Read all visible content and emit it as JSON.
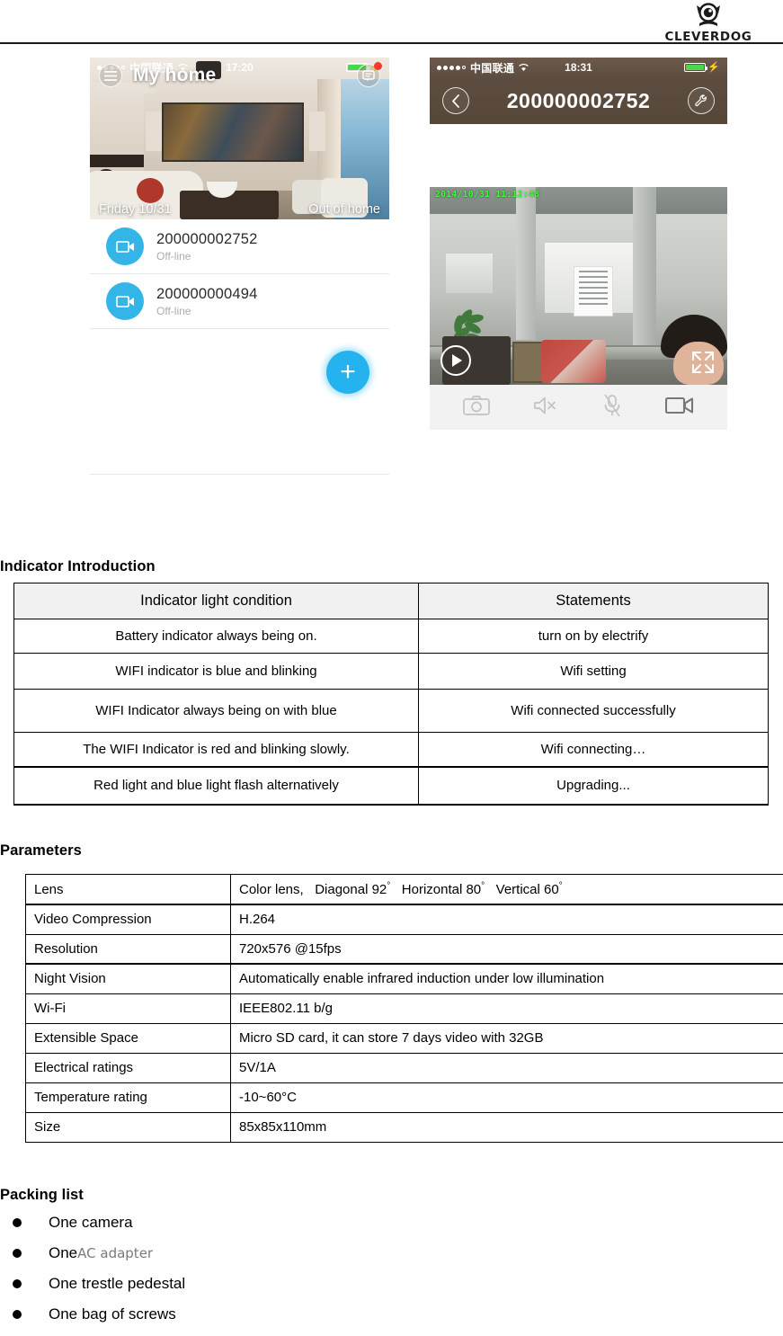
{
  "header": {
    "logo_text": "CLEVERDOG",
    "logo_icon": "cleverdog-camera-logo"
  },
  "app_screens": {
    "left": {
      "status_bar": {
        "carrier": "中国联通",
        "time": "17:20",
        "signal_icon": "signal-dots",
        "wifi_icon": "wifi-icon",
        "battery_icon": "battery-charging-icon"
      },
      "nav": {
        "menu_icon": "hamburger-menu-icon",
        "title": "My home",
        "message_icon": "message-bubble-icon",
        "badge": ""
      },
      "hero": {
        "date": "Friday  10/31",
        "mode": "Out of home"
      },
      "devices": [
        {
          "id": "200000002752",
          "status": "Off-line",
          "icon": "video-camera-icon"
        },
        {
          "id": "200000000494",
          "status": "Off-line",
          "icon": "video-camera-icon"
        }
      ],
      "fab": {
        "label": "+",
        "icon": "add-device-icon"
      }
    },
    "right": {
      "status_bar": {
        "carrier": "中国联通",
        "time": "18:31",
        "signal_icon": "signal-dots",
        "wifi_icon": "wifi-icon",
        "battery_icon": "battery-charging-icon"
      },
      "nav": {
        "back_icon": "back-chevron-icon",
        "title": "200000002752",
        "settings_icon": "wrench-icon"
      },
      "video": {
        "timestamp": "2014/10/31 11:12:48",
        "play_icon": "play-icon",
        "fullscreen_icon": "fullscreen-icon"
      },
      "toolbar": [
        {
          "icon": "camera-snapshot-icon",
          "name": "snapshot"
        },
        {
          "icon": "speaker-muted-icon",
          "name": "speaker-mute"
        },
        {
          "icon": "microphone-muted-icon",
          "name": "microphone-mute"
        },
        {
          "icon": "video-record-icon",
          "name": "record"
        }
      ]
    }
  },
  "indicator_section": {
    "title": "Indicator Introduction",
    "headers": [
      "Indicator light condition",
      "Statements"
    ],
    "rows": [
      [
        "Battery indicator always being on.",
        "turn on by electrify"
      ],
      [
        "WIFI indicator is blue and blinking",
        "Wifi setting"
      ],
      [
        "WIFI Indicator always being on with blue",
        "Wifi connected successfully"
      ],
      [
        "The WIFI Indicator is red and blinking slowly.",
        "Wifi connecting…"
      ],
      [
        "Red light and blue light flash alternatively",
        "Upgrading..."
      ]
    ]
  },
  "parameters_section": {
    "title": "Parameters",
    "rows": [
      {
        "label": "Lens",
        "value": "Color lens,   Diagonal 92",
        "value_suffix": "   Horizontal 80",
        "value_suffix2": "   Vertical 60",
        "degree": "°"
      },
      {
        "label": "Video Compression",
        "value": "H.264"
      },
      {
        "label": "Resolution",
        "value": "720x576 @15fps"
      },
      {
        "label": "Night Vision",
        "value": "Automatically enable infrared induction under low illumination"
      },
      {
        "label": "Wi-Fi",
        "value": "IEEE802.11 b/g"
      },
      {
        "label": "Extensible Space",
        "value": "Micro SD card, it can store 7 days video with 32GB"
      },
      {
        "label": "Electrical ratings",
        "value": "5V/1A"
      },
      {
        "label": "Temperature rating",
        "value": "-10~60°C"
      },
      {
        "label": "Size",
        "value": "85x85x110mm"
      }
    ]
  },
  "packing_section": {
    "title": "Packing list",
    "items": [
      {
        "text": "One camera"
      },
      {
        "text": "One ",
        "alt_text": "AC adapter"
      },
      {
        "text": "One trestle pedestal"
      },
      {
        "text": "One bag of screws"
      }
    ]
  },
  "colors": {
    "accent_blue": "#33b5e8",
    "fab_blue": "#24b3ef",
    "badge_red": "#f23b2f",
    "timestamp_green": "#3dfb3d",
    "table_header_bg": "#f1f1f1"
  }
}
